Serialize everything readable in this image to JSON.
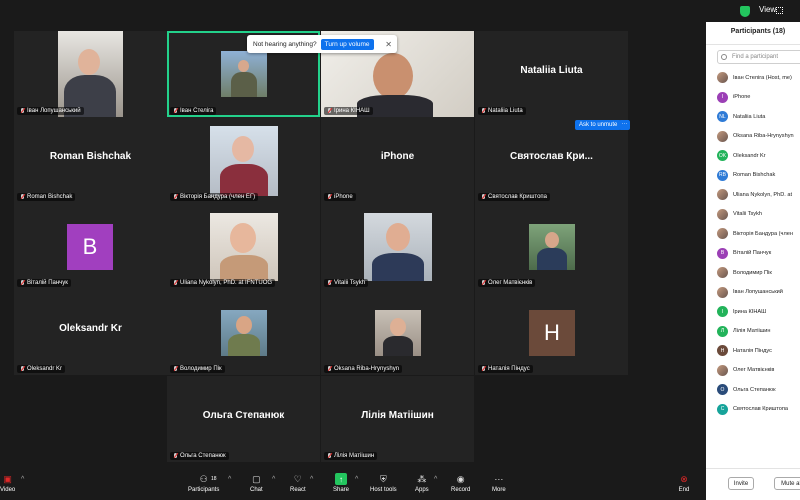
{
  "topbar": {
    "view_label": "View"
  },
  "notification": {
    "message": "Not hearing anything?",
    "button": "Turn up volume",
    "close": "✕"
  },
  "unmute": {
    "label": "Ask to unmute",
    "more": "···"
  },
  "tiles": [
    {
      "label": "Іван Лопушанський"
    },
    {
      "label": "Іван Стеліга"
    },
    {
      "label": "Ірина КІНАШ"
    },
    {
      "name": "Nataliia Liuta",
      "label": "Nataliia Liuta"
    },
    {
      "name": "Roman Bishchak",
      "label": "Roman Bishchak"
    },
    {
      "label": "Вікторія Бандура (член ЕГ)"
    },
    {
      "name": "iPhone",
      "label": "iPhone"
    },
    {
      "name": "Святослав  Кри...",
      "label": "Святослав Криштопа"
    },
    {
      "letter": "B",
      "label": "Віталій Панчук"
    },
    {
      "label": "Uliana Nykolyn, PhD. at IFNTUOG"
    },
    {
      "label": "Vitalii Tsykh"
    },
    {
      "label": "Олег Матвієнків"
    },
    {
      "name": "Oleksandr Kr",
      "label": "Oleksandr Kr"
    },
    {
      "label": "Володимир Пік"
    },
    {
      "label": "Oksana Riba-Hrynyshyn"
    },
    {
      "letter": "H",
      "label": "Наталія Піндус"
    },
    {
      "name": "Ольга Степанюк",
      "label": "Ольга Степанюк"
    },
    {
      "name": "Лілія Матіішин",
      "label": "Лілія Матіішин"
    }
  ],
  "participants_panel": {
    "title": "Participants (18)",
    "search_placeholder": "Find a participant",
    "items": [
      {
        "name": "Іван Стеліга (Host, me)",
        "initials": "",
        "color": ""
      },
      {
        "name": "iPhone",
        "initials": "I",
        "color": "#9b3fb5"
      },
      {
        "name": "Nataliia Liuta",
        "initials": "NL",
        "color": "#2f7bd6"
      },
      {
        "name": "Oksana Riba-Hrynyshyn",
        "initials": "",
        "color": ""
      },
      {
        "name": "Oleksandr Kr",
        "initials": "OK",
        "color": "#22b35a"
      },
      {
        "name": "Roman Bishchak",
        "initials": "RB",
        "color": "#2f7bd6"
      },
      {
        "name": "Uliana Nykolyn, PhD. at",
        "initials": "",
        "color": ""
      },
      {
        "name": "Vitalii Tsykh",
        "initials": "",
        "color": ""
      },
      {
        "name": "Вікторія Бандура (член",
        "initials": "",
        "color": ""
      },
      {
        "name": "Віталій Панчук",
        "initials": "B",
        "color": "#9b3fb5"
      },
      {
        "name": "Володимир Пік",
        "initials": "",
        "color": ""
      },
      {
        "name": "Іван Лопушанський",
        "initials": "",
        "color": ""
      },
      {
        "name": "Ірина КІНАШ",
        "initials": "I",
        "color": "#22b35a"
      },
      {
        "name": "Лілія Матіішин",
        "initials": "Л",
        "color": "#22b35a"
      },
      {
        "name": "Наталія Піндус",
        "initials": "H",
        "color": "#6b4a3a"
      },
      {
        "name": "Олег Матвієнків",
        "initials": "",
        "color": ""
      },
      {
        "name": "Ольга Степанюк",
        "initials": "O",
        "color": "#2a4c7a"
      },
      {
        "name": "Святослав Криштопа",
        "initials": "C",
        "color": "#16a39a"
      }
    ],
    "invite_label": "Invite",
    "mute_all_label": "Mute al"
  },
  "toolbar": {
    "video": "Video",
    "participants": "Participants",
    "participants_count": "18",
    "chat": "Chat",
    "react": "React",
    "share": "Share",
    "host_tools": "Host tools",
    "apps": "Apps",
    "record": "Record",
    "more": "More",
    "end": "End"
  },
  "colors": {
    "accent": "#0e72ed",
    "active_speaker": "#23d18b",
    "end": "#e02828"
  }
}
